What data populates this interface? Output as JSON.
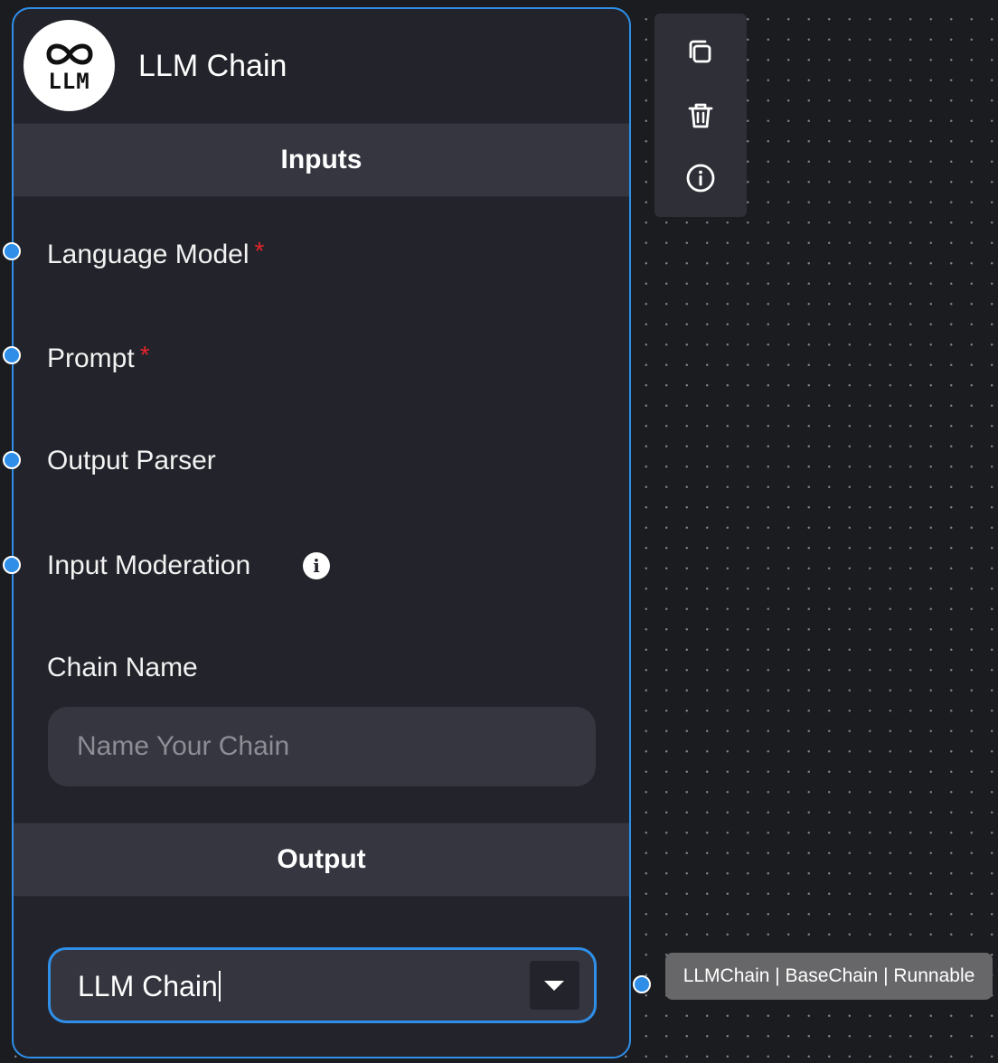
{
  "node": {
    "title": "LLM Chain",
    "logo_text": "LLM",
    "inputs_header": "Inputs",
    "inputs": [
      {
        "label": "Language Model",
        "required": "*"
      },
      {
        "label": "Prompt",
        "required": "*"
      },
      {
        "label": "Output Parser"
      },
      {
        "label": "Input Moderation",
        "info": "i"
      }
    ],
    "chain_name": {
      "label": "Chain Name",
      "placeholder": "Name Your Chain",
      "value": ""
    },
    "output_header": "Output",
    "output_select": {
      "selected": "LLM Chain"
    },
    "output_type": "LLMChain | BaseChain | Runnable"
  },
  "toolbar": {
    "icons": [
      "duplicate-icon",
      "trash-icon",
      "info-icon"
    ]
  },
  "colors": {
    "accent": "#2f8fe8",
    "node_bg": "#23242b",
    "section_bg": "#353640",
    "required": "#e5252a",
    "canvas_bg": "#1b1c20"
  }
}
